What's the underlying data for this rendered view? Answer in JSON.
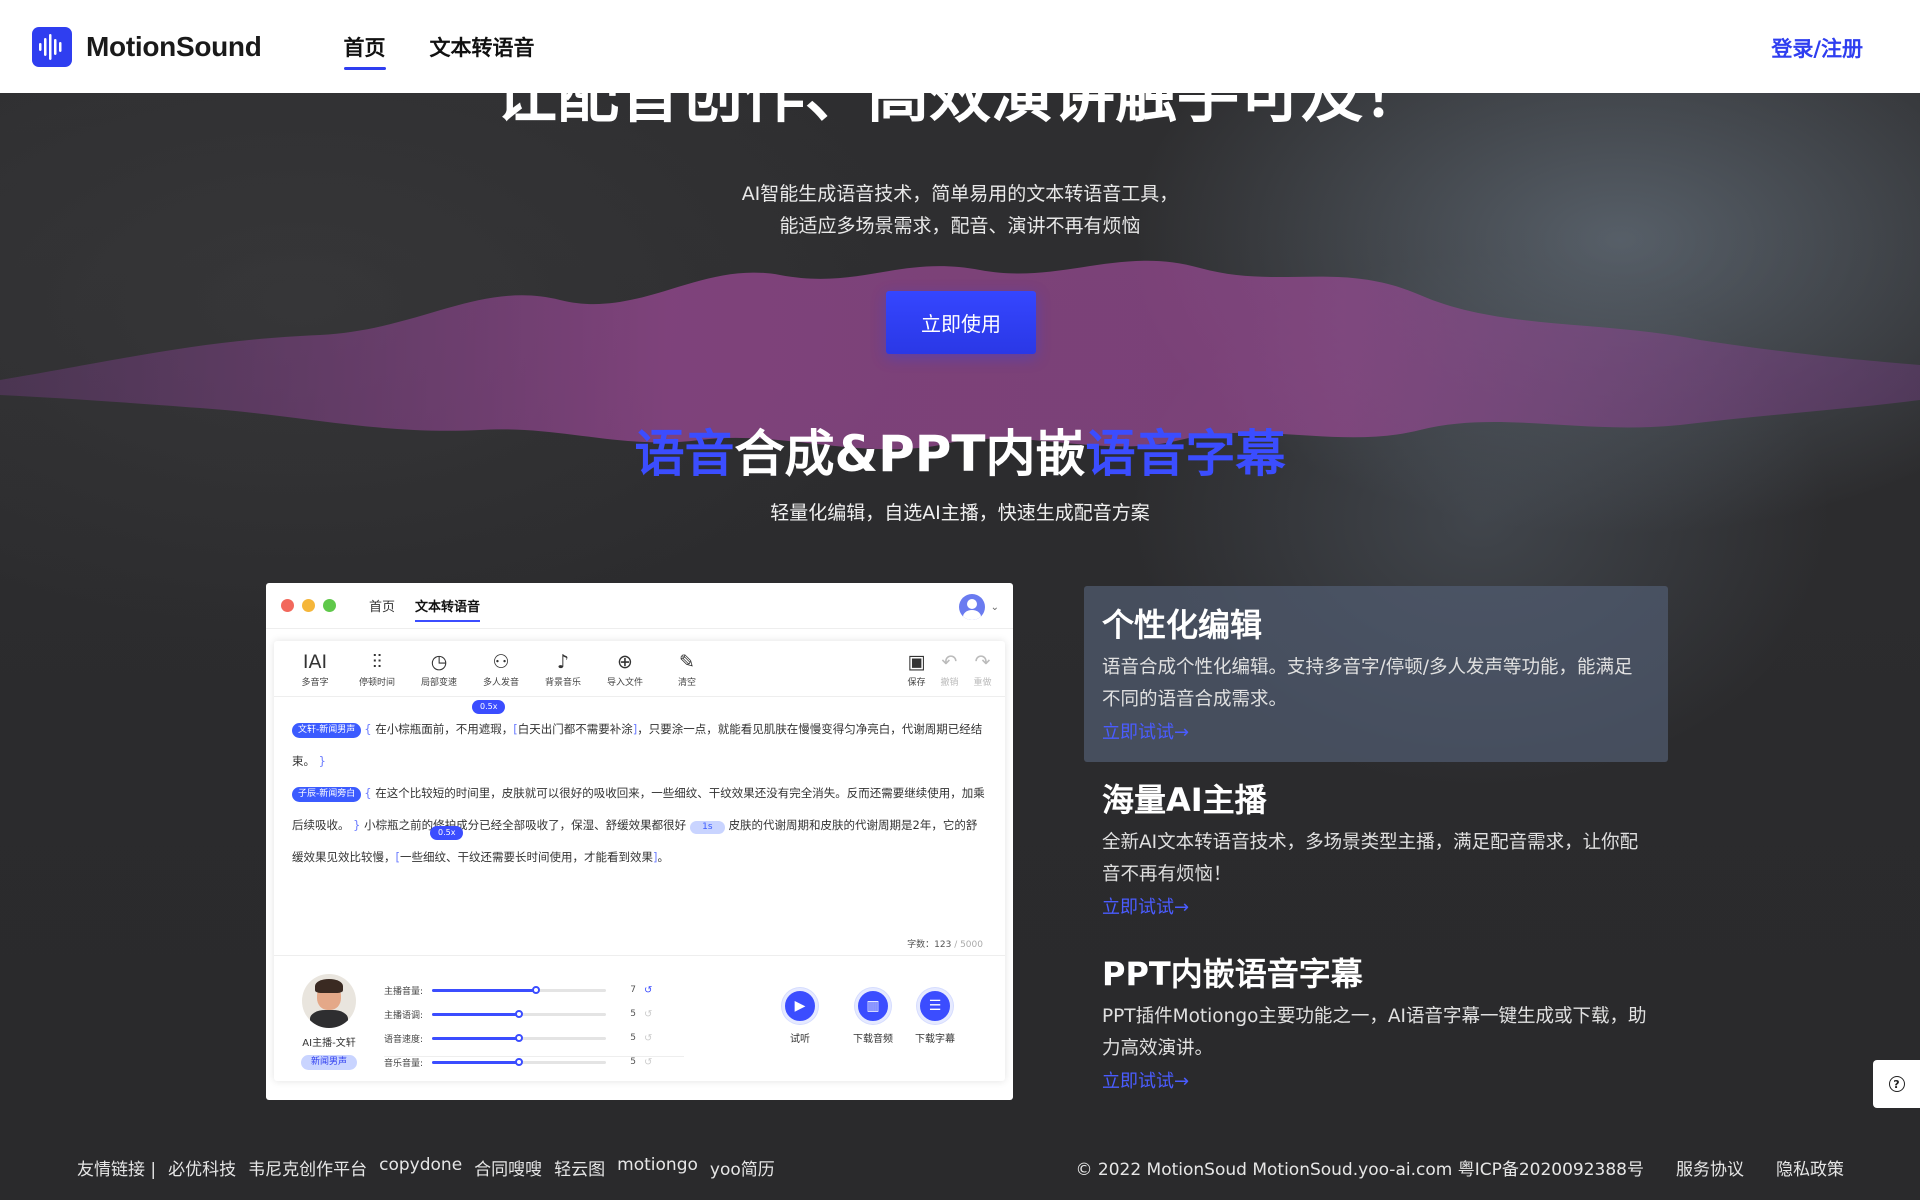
{
  "brand": {
    "name": "MotionSound",
    "accent": "#2f3ef0"
  },
  "nav": {
    "items": [
      {
        "label": "首页",
        "active": true
      },
      {
        "label": "文本转语音",
        "active": false
      }
    ],
    "login": "登录/注册"
  },
  "hero": {
    "title": "让配音创作、高效演讲触手可及！",
    "subtitle_line1": "AI智能生成语音技术，简单易用的文本转语音工具，",
    "subtitle_line2": "能适应多场景需求，配音、演讲不再有烦恼",
    "cta": "立即使用"
  },
  "section": {
    "title_part1": "语音",
    "title_part2": "合成&PPT内嵌",
    "title_part3": "语音字幕",
    "subtitle": "轻量化编辑，自选AI主播，快速生成配音方案"
  },
  "mock": {
    "nav": [
      "首页",
      "文本转语音"
    ],
    "tools": [
      "多音字",
      "停顿时间",
      "局部变速",
      "多人发音",
      "背景音乐",
      "导入文件",
      "清空"
    ],
    "tool_icons": [
      "IAI",
      "⫶⫶",
      "◷",
      "⚇",
      "♪",
      "⊕",
      "✎"
    ],
    "tools_right": [
      "保存",
      "撤销",
      "重做"
    ],
    "editor": {
      "tag1": "文轩-新闻男声",
      "p1a": "在小棕瓶面前，不用遮瑕，",
      "p1b": "白天出门都不需要补涂",
      "p1c": "，只要涂一点，就能看见肌肤在慢慢变得匀净亮白，代谢周期已经结束。",
      "tag2": "子辰-新闻旁白",
      "p2a": "在这个比较短的时间里，皮肤就可以很好的吸收回来，一些细纹、干纹效果还没有完全消失。反而还需要继续使用，加乘后续吸收。",
      "p2b": "小棕瓶之前的修护成分已经全部吸收了，保湿、舒缓效果都很好",
      "pill": "1s",
      "p2c": "皮肤的代谢周期和皮肤的代谢周期是2年，它的舒缓效果见效比较慢，",
      "p2d": "一些细纹、干纹还需要长时间使用，才能看到效果",
      "bubble1": "0.5x",
      "bubble2": "0.5x",
      "count_label": "字数：",
      "count_value": "123",
      "count_max": " / 5000"
    },
    "host": {
      "name": "AI主播-文轩",
      "tag": "新闻男声"
    },
    "sliders": [
      {
        "label": "主播音量:",
        "value": "7",
        "level": 0.6
      },
      {
        "label": "主播语调:",
        "value": "5",
        "level": 0.5
      },
      {
        "label": "语音速度:",
        "value": "5",
        "level": 0.5
      },
      {
        "label": "音乐音量:",
        "value": "5",
        "level": 0.5
      }
    ],
    "buttons": [
      {
        "label": "试听",
        "icon": "▶"
      },
      {
        "label": "下载音频",
        "icon": "▥"
      },
      {
        "label": "下载字幕",
        "icon": "☰"
      }
    ]
  },
  "features": [
    {
      "title": "个性化编辑",
      "desc": "语音合成个性化编辑。支持多音字/停顿/多人发声等功能，能满足不同的语音合成需求。",
      "link": "立即试试→"
    },
    {
      "title": "海量AI主播",
      "desc": "全新AI文本转语音技术，多场景类型主播，满足配音需求，让你配音不再有烦恼！",
      "link": "立即试试→"
    },
    {
      "title": "PPT内嵌语音字幕",
      "desc": "PPT插件Motiongo主要功能之一，AI语音字幕一键生成或下载，助力高效演讲。",
      "link": "立即试试→"
    }
  ],
  "help_icon": "?",
  "footer": {
    "links_label": "友情链接 |",
    "links": [
      "必优科技",
      "韦尼克创作平台",
      "copydone",
      "合同嗖嗖",
      "轻云图",
      "motiongo",
      "yoo简历"
    ],
    "copyright": "© 2022 MotionSoud MotionSoud.yoo-ai.com 粤ICP备2020092388号",
    "terms": "服务协议",
    "privacy": "隐私政策"
  }
}
